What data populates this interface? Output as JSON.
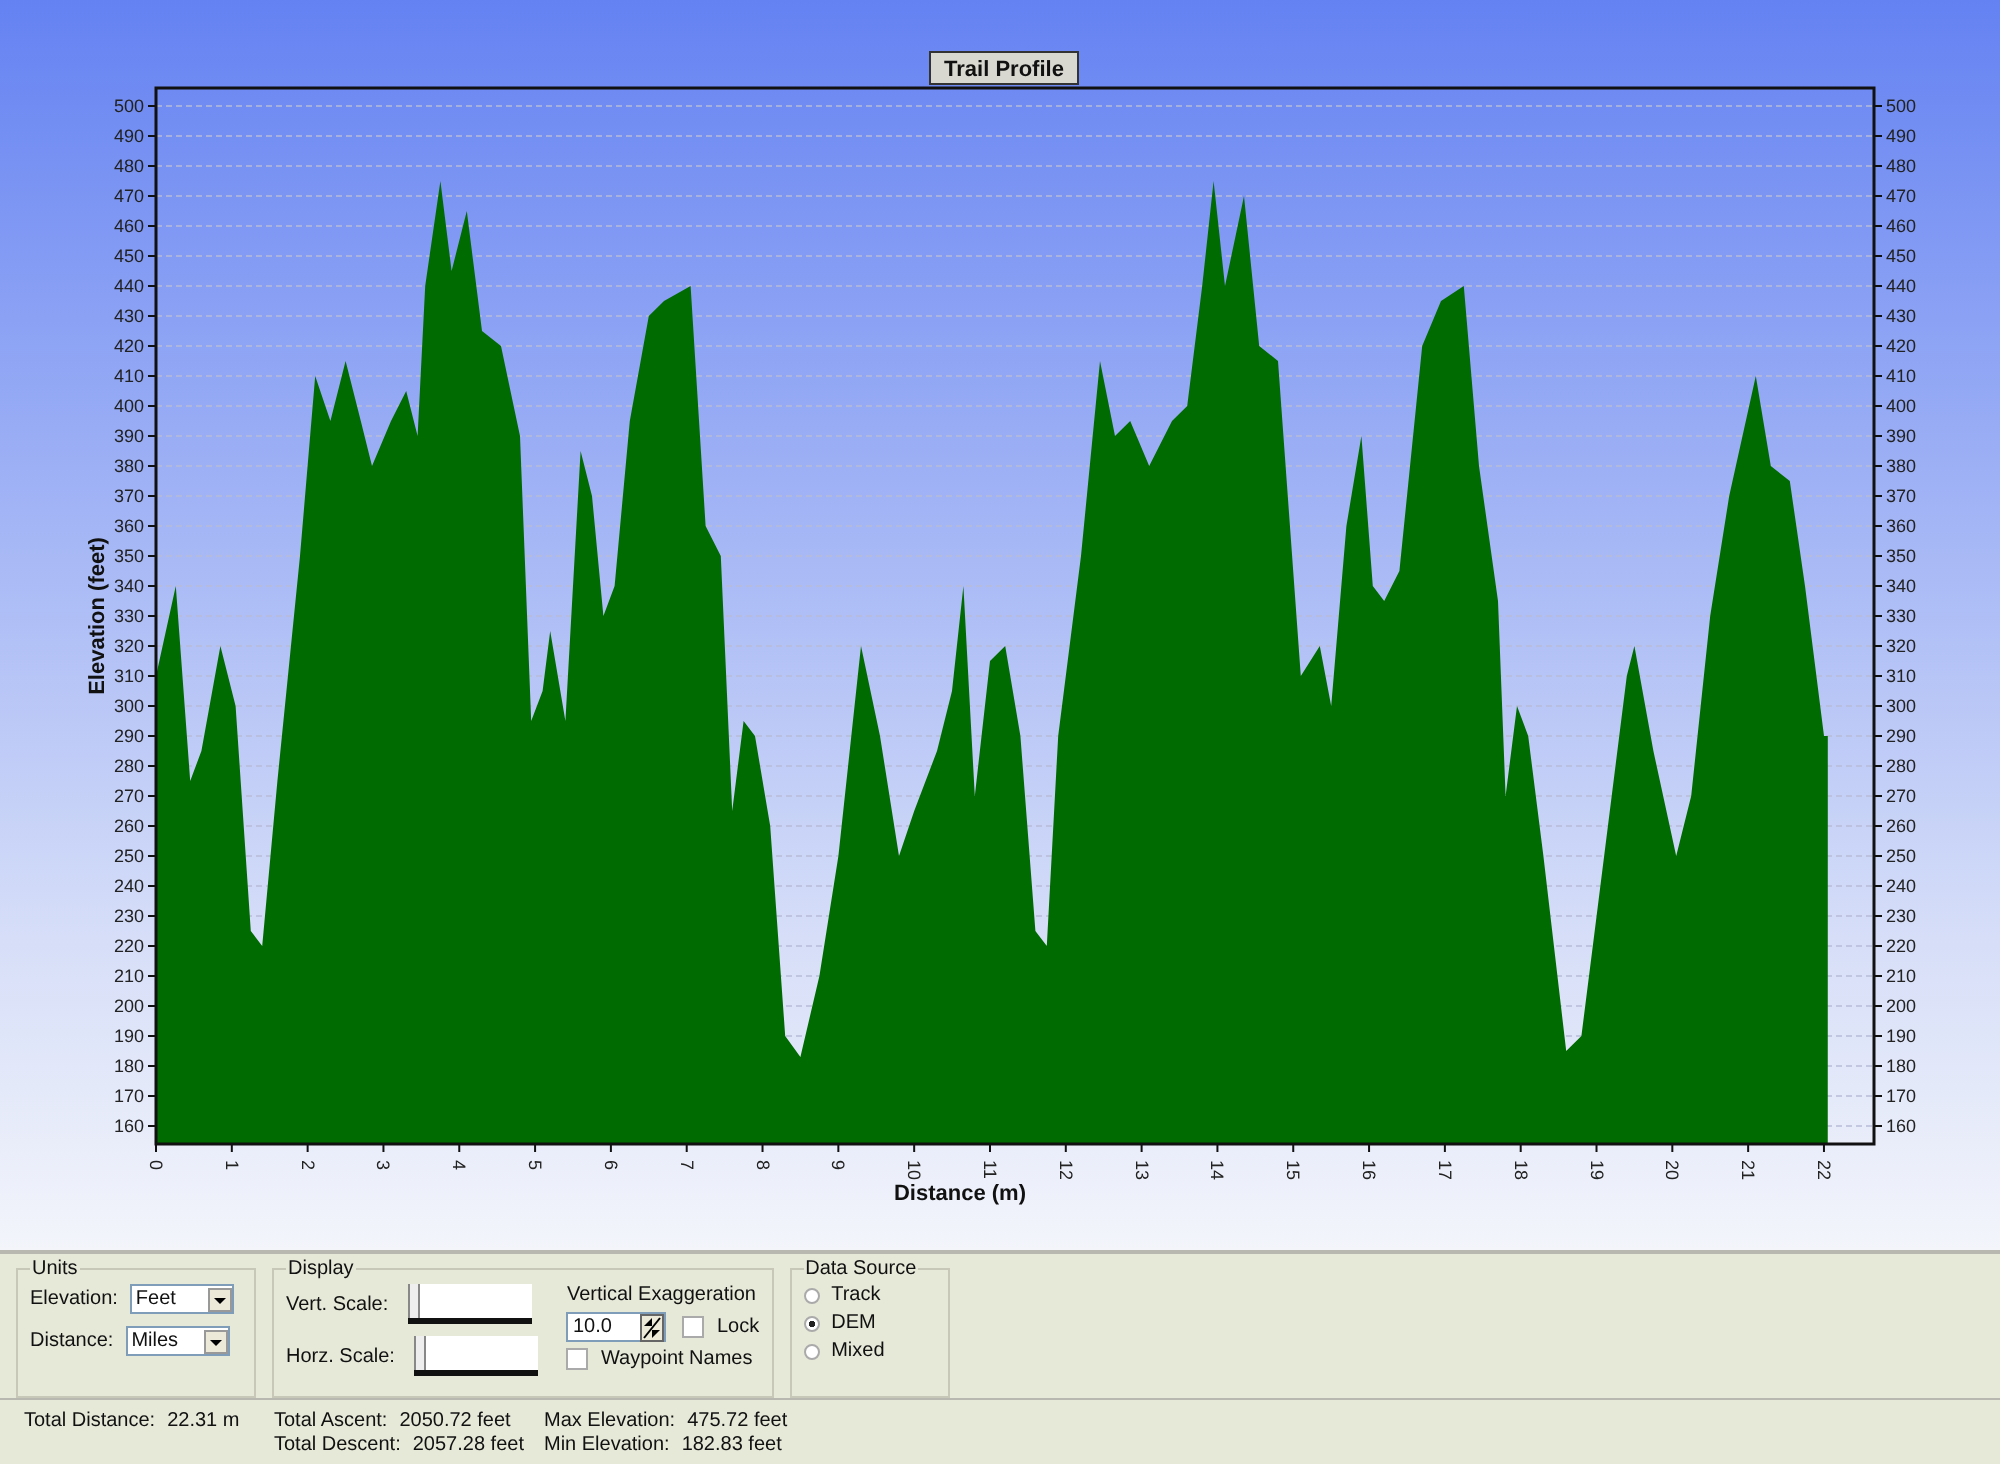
{
  "chart": {
    "chart_data": {
      "type": "area",
      "title": "Trail Profile",
      "xlabel": "Distance (m)",
      "ylabel": "Elevation (feet)",
      "xlim": [
        0,
        22.66
      ],
      "ylim": [
        154,
        506
      ],
      "xticks": [
        0,
        1,
        2,
        3,
        4,
        5,
        6,
        7,
        8,
        9,
        10,
        11,
        12,
        13,
        14,
        15,
        16,
        17,
        18,
        19,
        20,
        21,
        22
      ],
      "yticks": [
        160,
        170,
        180,
        190,
        200,
        210,
        220,
        230,
        240,
        250,
        260,
        270,
        280,
        290,
        300,
        310,
        320,
        330,
        340,
        350,
        360,
        370,
        380,
        390,
        400,
        410,
        420,
        430,
        440,
        450,
        460,
        470,
        480,
        490,
        500
      ],
      "x": [
        0,
        0.26,
        0.45,
        0.6,
        0.85,
        1.05,
        1.25,
        1.4,
        1.6,
        1.9,
        2.1,
        2.3,
        2.5,
        2.7,
        2.85,
        3.1,
        3.3,
        3.45,
        3.55,
        3.75,
        3.9,
        4.1,
        4.3,
        4.55,
        4.8,
        4.95,
        5.1,
        5.2,
        5.4,
        5.6,
        5.75,
        5.9,
        6.05,
        6.25,
        6.5,
        6.7,
        7.05,
        7.25,
        7.45,
        7.6,
        7.75,
        7.9,
        8.1,
        8.3,
        8.5,
        8.75,
        9.0,
        9.3,
        9.55,
        9.8,
        10.0,
        10.3,
        10.5,
        10.65,
        10.8,
        11.0,
        11.2,
        11.4,
        11.6,
        11.75,
        11.9,
        12.2,
        12.45,
        12.65,
        12.85,
        13.1,
        13.4,
        13.6,
        13.8,
        13.95,
        14.1,
        14.35,
        14.55,
        14.8,
        15.1,
        15.35,
        15.5,
        15.7,
        15.9,
        16.05,
        16.2,
        16.4,
        16.7,
        16.95,
        17.25,
        17.45,
        17.7,
        17.8,
        17.95,
        18.1,
        18.3,
        18.6,
        18.8,
        19.0,
        19.4,
        19.5,
        19.75,
        20.05,
        20.25,
        20.5,
        20.75,
        21.1,
        21.3,
        21.55,
        21.75,
        22.0,
        22.05
      ],
      "y2ticks": [
        160,
        170,
        180,
        190,
        200,
        210,
        220,
        230,
        240,
        250,
        260,
        270,
        280,
        290,
        300,
        310,
        320,
        330,
        340,
        350,
        360,
        370,
        380,
        390,
        400,
        410,
        420,
        430,
        440,
        450,
        460,
        470,
        480,
        490,
        500
      ],
      "y2lim": [
        154,
        506
      ],
      "grid": true,
      "series": [
        {
          "color": "#006b00",
          "values": [
            310,
            340,
            275,
            285,
            320,
            300,
            225,
            220,
            275,
            350,
            410,
            395,
            415,
            395,
            380,
            395,
            405,
            390,
            440,
            475,
            445,
            465,
            425,
            420,
            390,
            295,
            305,
            325,
            295,
            385,
            370,
            330,
            340,
            395,
            430,
            435,
            440,
            360,
            350,
            265,
            295,
            290,
            260,
            190,
            183,
            210,
            250,
            320,
            290,
            250,
            265,
            285,
            305,
            340,
            270,
            315,
            320,
            290,
            225,
            220,
            290,
            350,
            415,
            390,
            395,
            380,
            395,
            400,
            440,
            475,
            440,
            470,
            420,
            415,
            310,
            320,
            300,
            360,
            390,
            340,
            335,
            345,
            420,
            435,
            440,
            380,
            335,
            270,
            300,
            290,
            250,
            185,
            190,
            230,
            310,
            320,
            285,
            250,
            270,
            330,
            370,
            410,
            380,
            375,
            340,
            290,
            290
          ]
        }
      ]
    }
  },
  "units": {
    "title": "Units",
    "fields": [
      {
        "label": "Elevation:",
        "value": "Feet"
      },
      {
        "label": "Distance:",
        "value": "Miles"
      }
    ]
  },
  "display": {
    "title": "Display",
    "scales": [
      {
        "label": "Vert. Scale:",
        "level": 0
      },
      {
        "label": "Horz. Scale:",
        "level": 0
      }
    ],
    "exaggeration": {
      "label": "Vertical Exaggeration",
      "value": "10.0"
    },
    "checks": [
      {
        "label": "Lock",
        "checked": false
      },
      {
        "label": "Waypoint Names",
        "checked": false
      }
    ]
  },
  "data_source": {
    "title": "Data Source",
    "options": [
      {
        "label": "Track",
        "selected": false
      },
      {
        "label": "DEM",
        "selected": true
      },
      {
        "label": "Mixed",
        "selected": false
      }
    ]
  },
  "stats": [
    [
      {
        "label": "Total Distance:",
        "value": "22.31 m"
      }
    ],
    [
      {
        "label": "Total Ascent:",
        "value": "2050.72 feet"
      },
      {
        "label": "Total Descent:",
        "value": "2057.28 feet"
      }
    ],
    [
      {
        "label": "Max Elevation:",
        "value": "475.72 feet"
      },
      {
        "label": "Min Elevation:",
        "value": "182.83 feet"
      }
    ]
  ]
}
